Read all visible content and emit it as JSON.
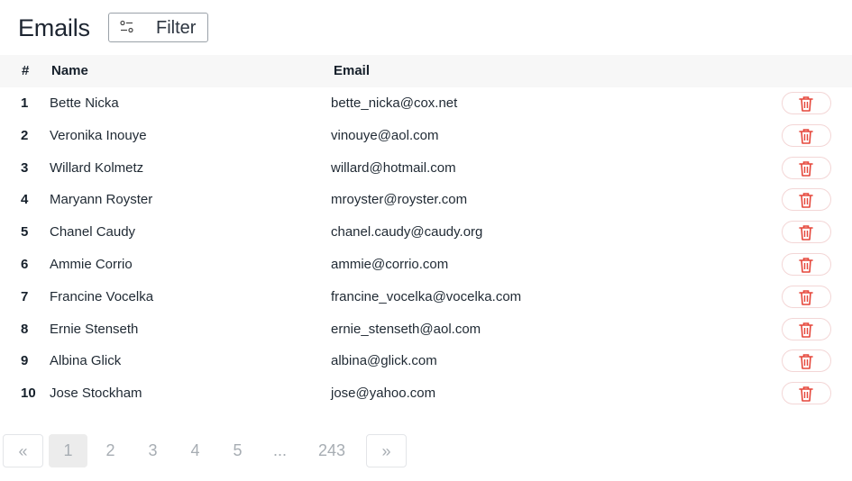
{
  "header": {
    "title": "Emails",
    "filter_label": "Filter",
    "filter_icon": "sliders-icon"
  },
  "table": {
    "columns": [
      "#",
      "Name",
      "Email"
    ],
    "rows": [
      {
        "num": "1",
        "name": "Bette Nicka",
        "email": "bette_nicka@cox.net"
      },
      {
        "num": "2",
        "name": "Veronika Inouye",
        "email": "vinouye@aol.com"
      },
      {
        "num": "3",
        "name": "Willard Kolmetz",
        "email": "willard@hotmail.com"
      },
      {
        "num": "4",
        "name": "Maryann Royster",
        "email": "mroyster@royster.com"
      },
      {
        "num": "5",
        "name": "Chanel Caudy",
        "email": "chanel.caudy@caudy.org"
      },
      {
        "num": "6",
        "name": "Ammie Corrio",
        "email": "ammie@corrio.com"
      },
      {
        "num": "7",
        "name": "Francine Vocelka",
        "email": "francine_vocelka@vocelka.com"
      },
      {
        "num": "8",
        "name": "Ernie Stenseth",
        "email": "ernie_stenseth@aol.com"
      },
      {
        "num": "9",
        "name": "Albina Glick",
        "email": "albina@glick.com"
      },
      {
        "num": "10",
        "name": "Jose Stockham",
        "email": "jose@yahoo.com"
      }
    ],
    "delete_icon": "trash-icon",
    "delete_color": "#e5463a"
  },
  "pagination": {
    "prev": "«",
    "pages": [
      "1",
      "2",
      "3",
      "4",
      "5",
      "...",
      "243"
    ],
    "active": "1",
    "next": "»"
  }
}
